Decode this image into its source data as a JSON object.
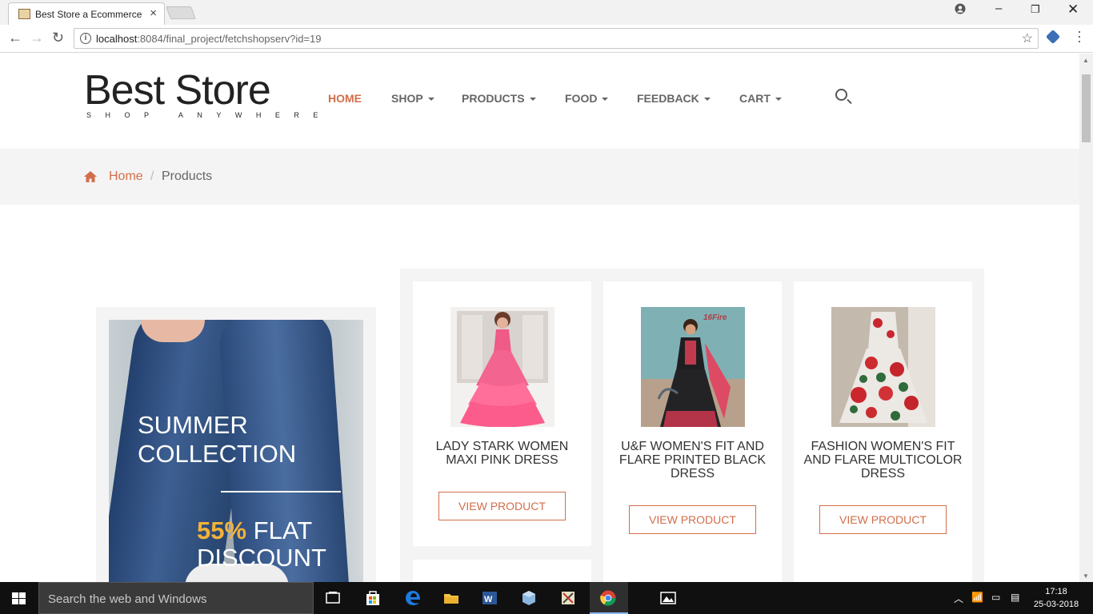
{
  "browser": {
    "tab_title": "Best Store a Ecommerce",
    "tab_close": "×",
    "url_host": "localhost",
    "url_rest": ":8084/final_project/fetchshopserv?id=19",
    "star": "☆"
  },
  "header": {
    "brand": "Best Store",
    "tagline": "SHOP ANYWHERE",
    "menu": [
      {
        "label": "HOME"
      },
      {
        "label": "SHOP"
      },
      {
        "label": "PRODUCTS"
      },
      {
        "label": "FOOD"
      },
      {
        "label": "FEEDBACK"
      },
      {
        "label": "CART"
      }
    ]
  },
  "breadcrumb": {
    "home": "Home",
    "separator": "/",
    "current": "Products"
  },
  "promo": {
    "line1": "SUMMER",
    "line2": "COLLECTION",
    "percent": "55%",
    "flat": "FLAT",
    "discount": "DISCOUNT"
  },
  "products": [
    {
      "name": "LADY STARK WOMEN MAXI PINK DRESS",
      "button": "VIEW PRODUCT"
    },
    {
      "name": "U&F WOMEN'S FIT AND FLARE PRINTED BLACK DRESS",
      "button": "VIEW PRODUCT"
    },
    {
      "name": "FASHION WOMEN'S FIT AND FLARE MULTICOLOR DRESS",
      "button": "VIEW PRODUCT"
    }
  ],
  "taskbar": {
    "search_placeholder": "Search the web and Windows",
    "time": "17:18",
    "date": "25-03-2018"
  },
  "colors": {
    "accent": "#d26e4b",
    "promo_highlight": "#f3b13a",
    "taskbar": "#101010"
  }
}
